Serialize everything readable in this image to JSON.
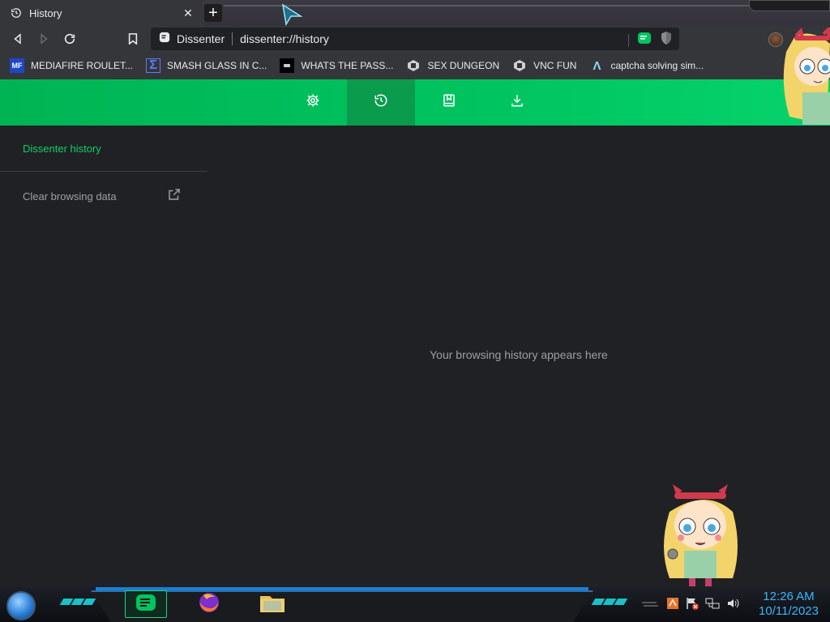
{
  "tab": {
    "title": "History",
    "close_label": "✕",
    "new_tab_label": "+"
  },
  "omnibox": {
    "site": "Dissenter",
    "url": "dissenter://history"
  },
  "bookmarks": [
    {
      "icon": "mediafire-icon",
      "icon_text": "MF",
      "label": "MEDIAFIRE ROULET..."
    },
    {
      "icon": "sigma-icon",
      "icon_text": "Σ",
      "label": "SMASH GLASS IN C..."
    },
    {
      "icon": "dark-site-icon",
      "icon_text": "",
      "label": "WHATS THE PASS..."
    },
    {
      "icon": "badge-icon",
      "icon_text": "",
      "label": "SEX DUNGEON"
    },
    {
      "icon": "badge-icon",
      "icon_text": "",
      "label": "VNC FUN"
    },
    {
      "icon": "lambda-icon",
      "icon_text": "Λ",
      "label": "captcha solving sim..."
    }
  ],
  "header_nav": [
    {
      "name": "settings",
      "icon": "gear-icon",
      "active": false
    },
    {
      "name": "history",
      "icon": "history-icon",
      "active": true
    },
    {
      "name": "bookmarks",
      "icon": "bookmark-book-icon",
      "active": false
    },
    {
      "name": "downloads",
      "icon": "download-icon",
      "active": false
    }
  ],
  "sidebar": {
    "title": "Dissenter history",
    "clear_label": "Clear browsing data"
  },
  "main": {
    "empty_message": "Your browsing history appears here"
  },
  "taskbar": {
    "apps": [
      "dissenter-browser",
      "firefox",
      "file-explorer"
    ],
    "clock_time": "12:26 AM",
    "clock_date": "10/11/2023"
  },
  "colors": {
    "accent_green": "#00c460",
    "active_green": "#0b9b4d",
    "sidebar_title": "#0ecf6a",
    "clock": "#37b7ff"
  }
}
